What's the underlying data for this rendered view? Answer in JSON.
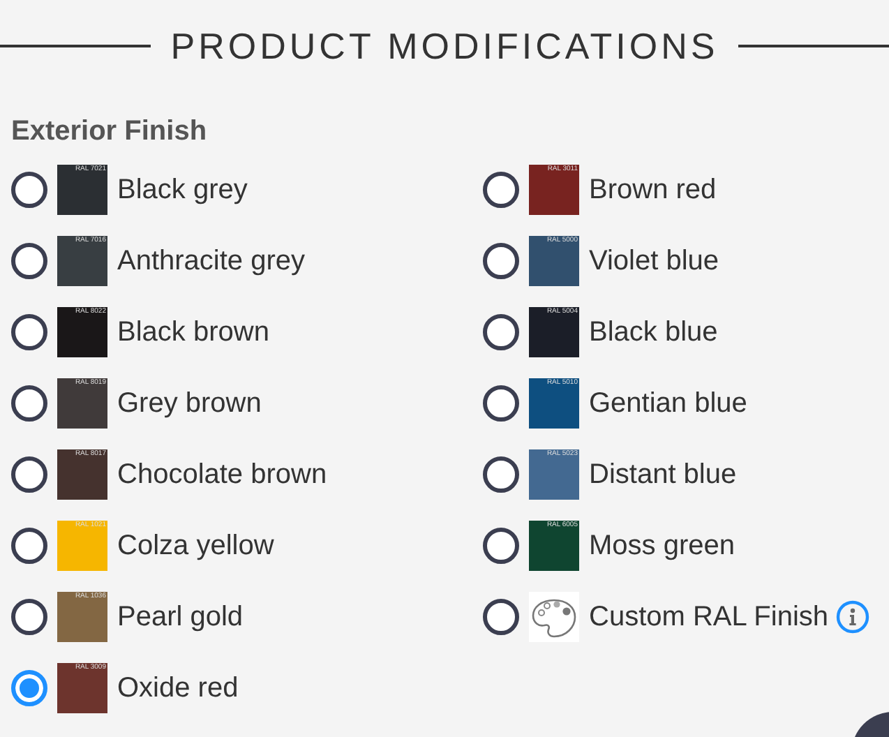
{
  "section_title": "PRODUCT MODIFICATIONS",
  "group_label": "Exterior Finish",
  "options": [
    {
      "kind": "swatch",
      "label": "Black grey",
      "code": "RAL 7021",
      "color": "#2b2f33",
      "selected": false
    },
    {
      "kind": "swatch",
      "label": "Anthracite grey",
      "code": "RAL 7016",
      "color": "#383e42",
      "selected": false
    },
    {
      "kind": "swatch",
      "label": "Black brown",
      "code": "RAL 8022",
      "color": "#1a1718",
      "selected": false
    },
    {
      "kind": "swatch",
      "label": "Grey brown",
      "code": "RAL 8019",
      "color": "#403a3a",
      "selected": false
    },
    {
      "kind": "swatch",
      "label": "Chocolate brown",
      "code": "RAL 8017",
      "color": "#45322e",
      "selected": false
    },
    {
      "kind": "swatch",
      "label": "Colza yellow",
      "code": "RAL 1021",
      "color": "#f6b600",
      "selected": false
    },
    {
      "kind": "swatch",
      "label": "Pearl gold",
      "code": "RAL 1036",
      "color": "#836743",
      "selected": false
    },
    {
      "kind": "swatch",
      "label": "Oxide red",
      "code": "RAL 3009",
      "color": "#6d342d",
      "selected": true
    },
    {
      "kind": "swatch",
      "label": "Brown red",
      "code": "RAL 3011",
      "color": "#782320",
      "selected": false
    },
    {
      "kind": "swatch",
      "label": "Violet blue",
      "code": "RAL 5000",
      "color": "#31506e",
      "selected": false
    },
    {
      "kind": "swatch",
      "label": "Black blue",
      "code": "RAL 5004",
      "color": "#1b1e28",
      "selected": false
    },
    {
      "kind": "swatch",
      "label": "Gentian blue",
      "code": "RAL 5010",
      "color": "#0e4f80",
      "selected": false
    },
    {
      "kind": "swatch",
      "label": "Distant blue",
      "code": "RAL 5023",
      "color": "#436991",
      "selected": false
    },
    {
      "kind": "swatch",
      "label": "Moss green",
      "code": "RAL 6005",
      "color": "#0f4530",
      "selected": false
    },
    {
      "kind": "custom",
      "label": "Custom RAL Finish",
      "selected": false
    }
  ]
}
